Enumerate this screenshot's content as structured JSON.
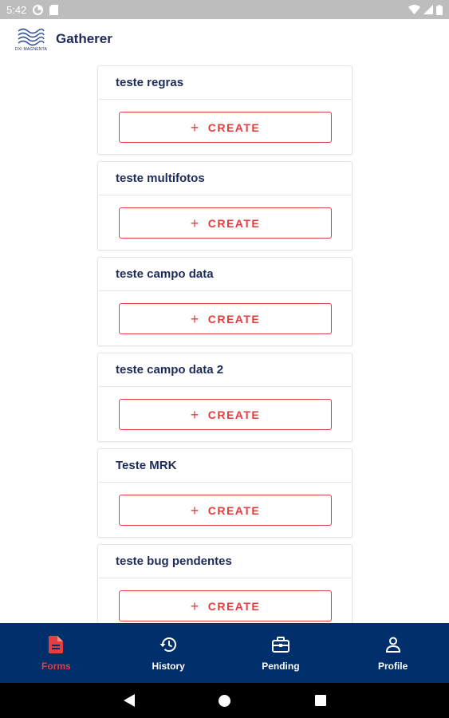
{
  "status_bar": {
    "time": "5:42",
    "icons": [
      "data-saver-icon",
      "sd-card-icon",
      "wifi-icon",
      "signal-icon",
      "battery-icon"
    ]
  },
  "app_bar": {
    "title": "Gatherer",
    "logo_caption": "DXI MAGNENTA"
  },
  "forms": [
    {
      "title": "teste regras",
      "create_label": "CREATE"
    },
    {
      "title": "teste multifotos",
      "create_label": "CREATE"
    },
    {
      "title": "teste campo data",
      "create_label": "CREATE"
    },
    {
      "title": "teste campo data 2",
      "create_label": "CREATE"
    },
    {
      "title": "Teste MRK",
      "create_label": "CREATE"
    },
    {
      "title": "teste bug pendentes",
      "create_label": "CREATE"
    }
  ],
  "bottom_nav": {
    "items": [
      {
        "label": "Forms",
        "icon": "document-icon",
        "active": true
      },
      {
        "label": "History",
        "icon": "history-icon",
        "active": false
      },
      {
        "label": "Pending",
        "icon": "briefcase-icon",
        "active": false
      },
      {
        "label": "Profile",
        "icon": "person-icon",
        "active": false
      }
    ]
  },
  "colors": {
    "accent": "#e53e3e",
    "navy": "#002f6c",
    "text": "#1d2a5c",
    "status_bar": "#bdbdbd"
  }
}
